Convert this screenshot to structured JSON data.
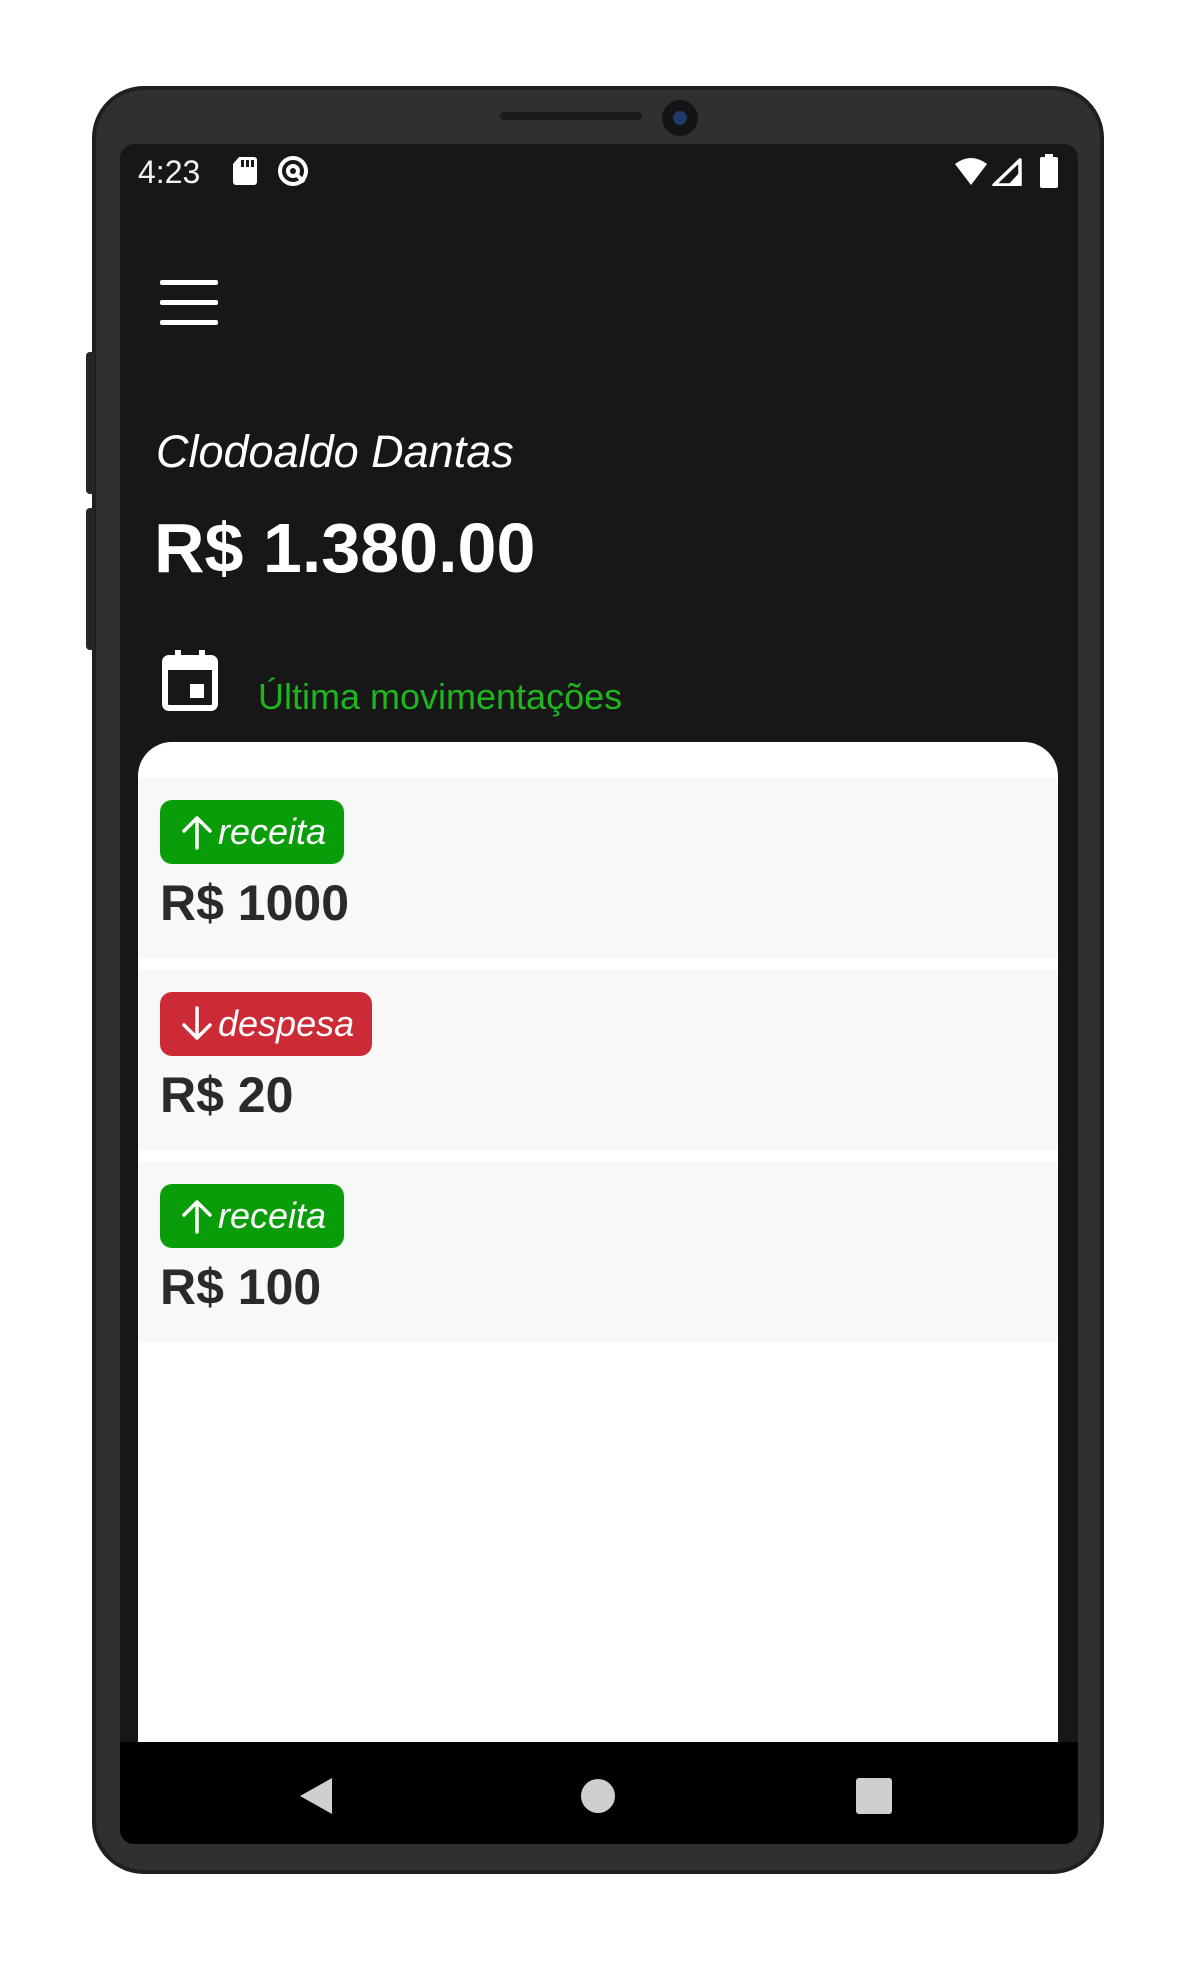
{
  "status_bar": {
    "time": "4:23",
    "left_icons": [
      "sd-card-icon",
      "data-saver-icon"
    ],
    "right_icons": [
      "wifi-icon",
      "cell-signal-icon",
      "battery-icon"
    ]
  },
  "header": {
    "menu_icon": "hamburger-menu-icon",
    "user_name": "Clodoaldo Dantas",
    "balance": "R$ 1.380.00"
  },
  "section": {
    "icon": "calendar-icon",
    "title": "Última movimentações"
  },
  "transactions": [
    {
      "type": "receita",
      "direction": "up",
      "amount": "R$ 1000"
    },
    {
      "type": "despesa",
      "direction": "down",
      "amount": "R$ 20"
    },
    {
      "type": "receita",
      "direction": "up",
      "amount": "R$ 100"
    }
  ],
  "colors": {
    "background": "#171717",
    "accent_green": "#1fb51f",
    "badge_income": "#0a9d0a",
    "badge_expense": "#cc2a35",
    "panel": "#ffffff",
    "item": "#f8f8f8"
  },
  "nav_bar": {
    "buttons": [
      "back-icon",
      "home-icon",
      "recents-icon"
    ]
  }
}
